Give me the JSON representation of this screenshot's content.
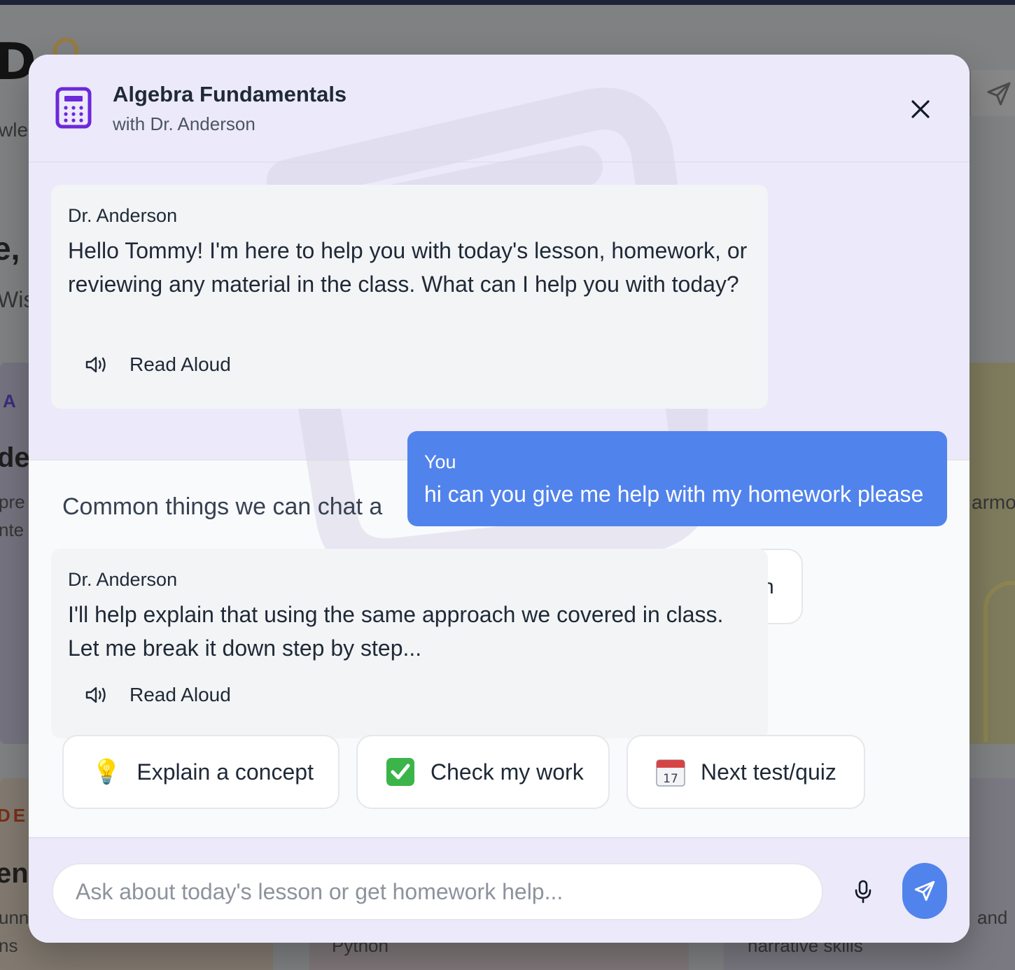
{
  "background": {
    "snippets": [
      "wled",
      "e, T",
      "Wis",
      "A F",
      "der",
      "pre",
      "nte",
      "armo",
      "DE",
      "en",
      "unn",
      "ns",
      "Python",
      "and",
      "narrative skills"
    ]
  },
  "modal": {
    "title": "Algebra Fundamentals",
    "subtitle": "with Dr. Anderson",
    "header_icon": "calculator-icon",
    "close_icon": "close-icon"
  },
  "messages": [
    {
      "author": "Dr. Anderson",
      "text": "Hello Tommy! I'm here to help you with today's lesson, homework, or reviewing any material in the class. What can I help you with today?",
      "read_aloud": "Read Aloud"
    },
    {
      "author": "You",
      "text": "hi can you give me help with my homework please"
    },
    {
      "author": "Dr. Anderson",
      "text": "I'll help explain that using the same approach we covered in class. Let me break it down step by step...",
      "read_aloud": "Read Aloud"
    }
  ],
  "topics": {
    "title": "Common things we can chat a",
    "hidden_chip_fragment": "n",
    "quick_actions": [
      {
        "icon": "💡",
        "label": "Explain a concept"
      },
      {
        "icon": "✅",
        "label": "Check my work"
      },
      {
        "icon": "📅",
        "label": "Next test/quiz"
      }
    ]
  },
  "input": {
    "placeholder": "Ask about today's lesson or get homework help...",
    "value": ""
  },
  "colors": {
    "accent": "#5183ec",
    "brand_purple": "#6d28d9",
    "header_band": "#ece9fb"
  }
}
